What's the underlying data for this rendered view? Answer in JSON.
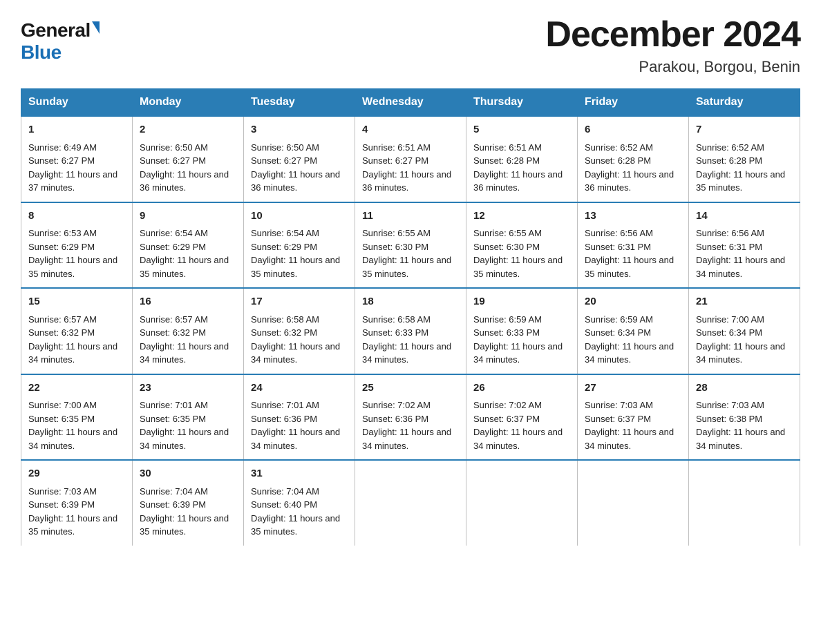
{
  "logo": {
    "general": "General",
    "blue": "Blue"
  },
  "title": "December 2024",
  "subtitle": "Parakou, Borgou, Benin",
  "headers": [
    "Sunday",
    "Monday",
    "Tuesday",
    "Wednesday",
    "Thursday",
    "Friday",
    "Saturday"
  ],
  "weeks": [
    [
      {
        "day": "1",
        "sunrise": "6:49 AM",
        "sunset": "6:27 PM",
        "daylight": "11 hours and 37 minutes."
      },
      {
        "day": "2",
        "sunrise": "6:50 AM",
        "sunset": "6:27 PM",
        "daylight": "11 hours and 36 minutes."
      },
      {
        "day": "3",
        "sunrise": "6:50 AM",
        "sunset": "6:27 PM",
        "daylight": "11 hours and 36 minutes."
      },
      {
        "day": "4",
        "sunrise": "6:51 AM",
        "sunset": "6:27 PM",
        "daylight": "11 hours and 36 minutes."
      },
      {
        "day": "5",
        "sunrise": "6:51 AM",
        "sunset": "6:28 PM",
        "daylight": "11 hours and 36 minutes."
      },
      {
        "day": "6",
        "sunrise": "6:52 AM",
        "sunset": "6:28 PM",
        "daylight": "11 hours and 36 minutes."
      },
      {
        "day": "7",
        "sunrise": "6:52 AM",
        "sunset": "6:28 PM",
        "daylight": "11 hours and 35 minutes."
      }
    ],
    [
      {
        "day": "8",
        "sunrise": "6:53 AM",
        "sunset": "6:29 PM",
        "daylight": "11 hours and 35 minutes."
      },
      {
        "day": "9",
        "sunrise": "6:54 AM",
        "sunset": "6:29 PM",
        "daylight": "11 hours and 35 minutes."
      },
      {
        "day": "10",
        "sunrise": "6:54 AM",
        "sunset": "6:29 PM",
        "daylight": "11 hours and 35 minutes."
      },
      {
        "day": "11",
        "sunrise": "6:55 AM",
        "sunset": "6:30 PM",
        "daylight": "11 hours and 35 minutes."
      },
      {
        "day": "12",
        "sunrise": "6:55 AM",
        "sunset": "6:30 PM",
        "daylight": "11 hours and 35 minutes."
      },
      {
        "day": "13",
        "sunrise": "6:56 AM",
        "sunset": "6:31 PM",
        "daylight": "11 hours and 35 minutes."
      },
      {
        "day": "14",
        "sunrise": "6:56 AM",
        "sunset": "6:31 PM",
        "daylight": "11 hours and 34 minutes."
      }
    ],
    [
      {
        "day": "15",
        "sunrise": "6:57 AM",
        "sunset": "6:32 PM",
        "daylight": "11 hours and 34 minutes."
      },
      {
        "day": "16",
        "sunrise": "6:57 AM",
        "sunset": "6:32 PM",
        "daylight": "11 hours and 34 minutes."
      },
      {
        "day": "17",
        "sunrise": "6:58 AM",
        "sunset": "6:32 PM",
        "daylight": "11 hours and 34 minutes."
      },
      {
        "day": "18",
        "sunrise": "6:58 AM",
        "sunset": "6:33 PM",
        "daylight": "11 hours and 34 minutes."
      },
      {
        "day": "19",
        "sunrise": "6:59 AM",
        "sunset": "6:33 PM",
        "daylight": "11 hours and 34 minutes."
      },
      {
        "day": "20",
        "sunrise": "6:59 AM",
        "sunset": "6:34 PM",
        "daylight": "11 hours and 34 minutes."
      },
      {
        "day": "21",
        "sunrise": "7:00 AM",
        "sunset": "6:34 PM",
        "daylight": "11 hours and 34 minutes."
      }
    ],
    [
      {
        "day": "22",
        "sunrise": "7:00 AM",
        "sunset": "6:35 PM",
        "daylight": "11 hours and 34 minutes."
      },
      {
        "day": "23",
        "sunrise": "7:01 AM",
        "sunset": "6:35 PM",
        "daylight": "11 hours and 34 minutes."
      },
      {
        "day": "24",
        "sunrise": "7:01 AM",
        "sunset": "6:36 PM",
        "daylight": "11 hours and 34 minutes."
      },
      {
        "day": "25",
        "sunrise": "7:02 AM",
        "sunset": "6:36 PM",
        "daylight": "11 hours and 34 minutes."
      },
      {
        "day": "26",
        "sunrise": "7:02 AM",
        "sunset": "6:37 PM",
        "daylight": "11 hours and 34 minutes."
      },
      {
        "day": "27",
        "sunrise": "7:03 AM",
        "sunset": "6:37 PM",
        "daylight": "11 hours and 34 minutes."
      },
      {
        "day": "28",
        "sunrise": "7:03 AM",
        "sunset": "6:38 PM",
        "daylight": "11 hours and 34 minutes."
      }
    ],
    [
      {
        "day": "29",
        "sunrise": "7:03 AM",
        "sunset": "6:39 PM",
        "daylight": "11 hours and 35 minutes."
      },
      {
        "day": "30",
        "sunrise": "7:04 AM",
        "sunset": "6:39 PM",
        "daylight": "11 hours and 35 minutes."
      },
      {
        "day": "31",
        "sunrise": "7:04 AM",
        "sunset": "6:40 PM",
        "daylight": "11 hours and 35 minutes."
      },
      null,
      null,
      null,
      null
    ]
  ],
  "labels": {
    "sunrise": "Sunrise:",
    "sunset": "Sunset:",
    "daylight": "Daylight:"
  }
}
